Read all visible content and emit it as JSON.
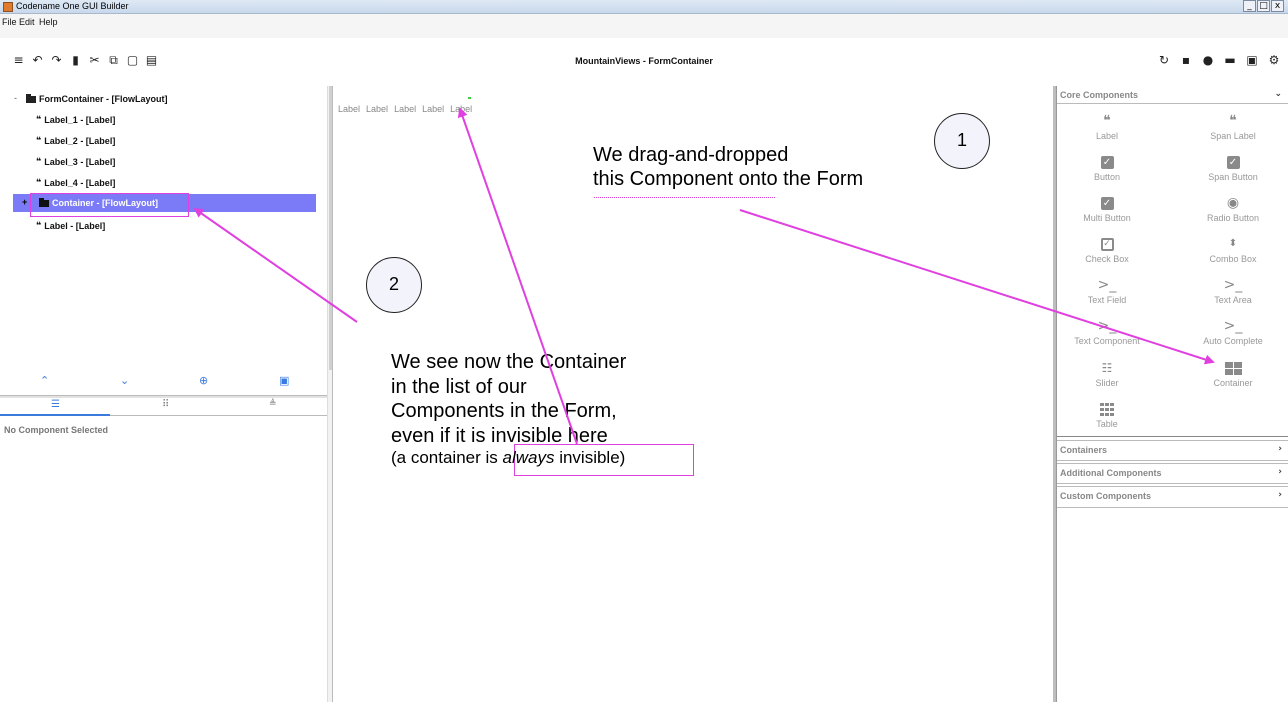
{
  "window": {
    "title": "Codename One GUI Builder",
    "min": "_",
    "max": "□",
    "close": "x"
  },
  "menu": [
    "File",
    "Edit",
    "Help"
  ],
  "toolbar": {
    "title": "MountainViews - FormContainer",
    "left_icons": [
      "menu-icon",
      "undo-icon",
      "redo-icon",
      "delete-icon",
      "cut-icon",
      "copy-icon",
      "paste-icon",
      "preview-icon"
    ],
    "right_icons": [
      "refresh-icon",
      "save-icon",
      "theme-icon",
      "export-icon",
      "lock-icon",
      "settings-icon"
    ]
  },
  "tree": {
    "root": "FormContainer - [FlowLayout]",
    "items": [
      "Label_1 - [Label]",
      "Label_2 - [Label]",
      "Label_3 - [Label]",
      "Label_4 - [Label]",
      "Container - [FlowLayout]",
      "Label - [Label]"
    ],
    "expand_root": "-",
    "expand_container": "+"
  },
  "left_bottom": {
    "no_selection": "No Component Selected"
  },
  "canvas": {
    "labels": [
      "Label",
      "Label",
      "Label",
      "Label",
      "Label"
    ]
  },
  "palette": {
    "core_title": "Core Components",
    "items": [
      {
        "label": "Label",
        "icon": "quote-icon"
      },
      {
        "label": "Span Label",
        "icon": "quote-icon"
      },
      {
        "label": "Button",
        "icon": "check-box-icon"
      },
      {
        "label": "Span Button",
        "icon": "check-box-icon"
      },
      {
        "label": "Multi Button",
        "icon": "check-box-icon"
      },
      {
        "label": "Radio Button",
        "icon": "radio-icon"
      },
      {
        "label": "Check Box",
        "icon": "checkbox-outline-icon"
      },
      {
        "label": "Combo Box",
        "icon": "updown-icon"
      },
      {
        "label": "Text Field",
        "icon": "prompt-icon"
      },
      {
        "label": "Text Area",
        "icon": "prompt-icon"
      },
      {
        "label": "Text Component",
        "icon": "prompt-icon"
      },
      {
        "label": "Auto Complete",
        "icon": "prompt-icon"
      },
      {
        "label": "Slider",
        "icon": "slider-icon"
      },
      {
        "label": "Container",
        "icon": "grid-icon"
      },
      {
        "label": "Table",
        "icon": "table-icon"
      }
    ],
    "sections": [
      "Containers",
      "Additional Components",
      "Custom Components"
    ]
  },
  "annotations": {
    "circle1": "1",
    "circle2": "2",
    "note1_line1": "We drag-and-dropped",
    "note1_line2": "this Component onto the Form",
    "note2_line1": "We see now the Container",
    "note2_line2": "in the list of our",
    "note2_line3": "Components in the Form,",
    "note2_line4a": "even if it is ",
    "note2_line4b": "invisible here",
    "note2_line5a": "(a container is ",
    "note2_line5b": "always",
    "note2_line5c": " invisible)",
    "accent_color": "#e040e0"
  }
}
